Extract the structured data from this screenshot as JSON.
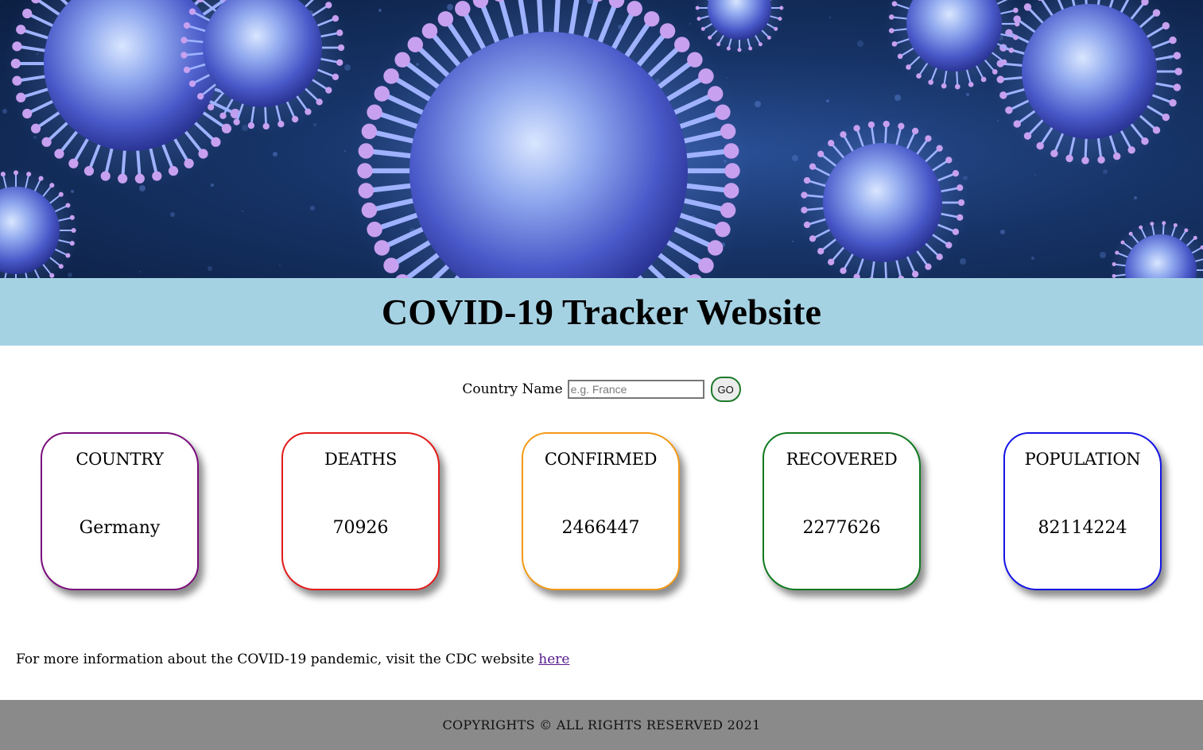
{
  "hero": {
    "image_description_icon": "virus-image"
  },
  "header": {
    "title": "COVID-19 Tracker Website",
    "band_color": "#a5d2e3"
  },
  "search": {
    "label": "Country Name",
    "value": "",
    "placeholder": "e.g. France",
    "button_label": "GO"
  },
  "cards": {
    "country": {
      "label": "COUNTRY",
      "value": "Germany",
      "border_color": "#7a0c7c"
    },
    "deaths": {
      "label": "DEATHS",
      "value": "70926",
      "border_color": "#e31b1b"
    },
    "confirmed": {
      "label": "CONFIRMED",
      "value": "2466447",
      "border_color": "#f39a17"
    },
    "recovered": {
      "label": "RECOVERED",
      "value": "2277626",
      "border_color": "#0f7a1e"
    },
    "population": {
      "label": "POPULATION",
      "value": "82114224",
      "border_color": "#1414e6"
    }
  },
  "info": {
    "text": "For more information about the COVID-19 pandemic, visit the CDC website ",
    "link_text": "here"
  },
  "footer": {
    "text": "COPYRIGHTS © ALL RIGHTS RESERVED 2021",
    "color": "#8a8a8a"
  }
}
